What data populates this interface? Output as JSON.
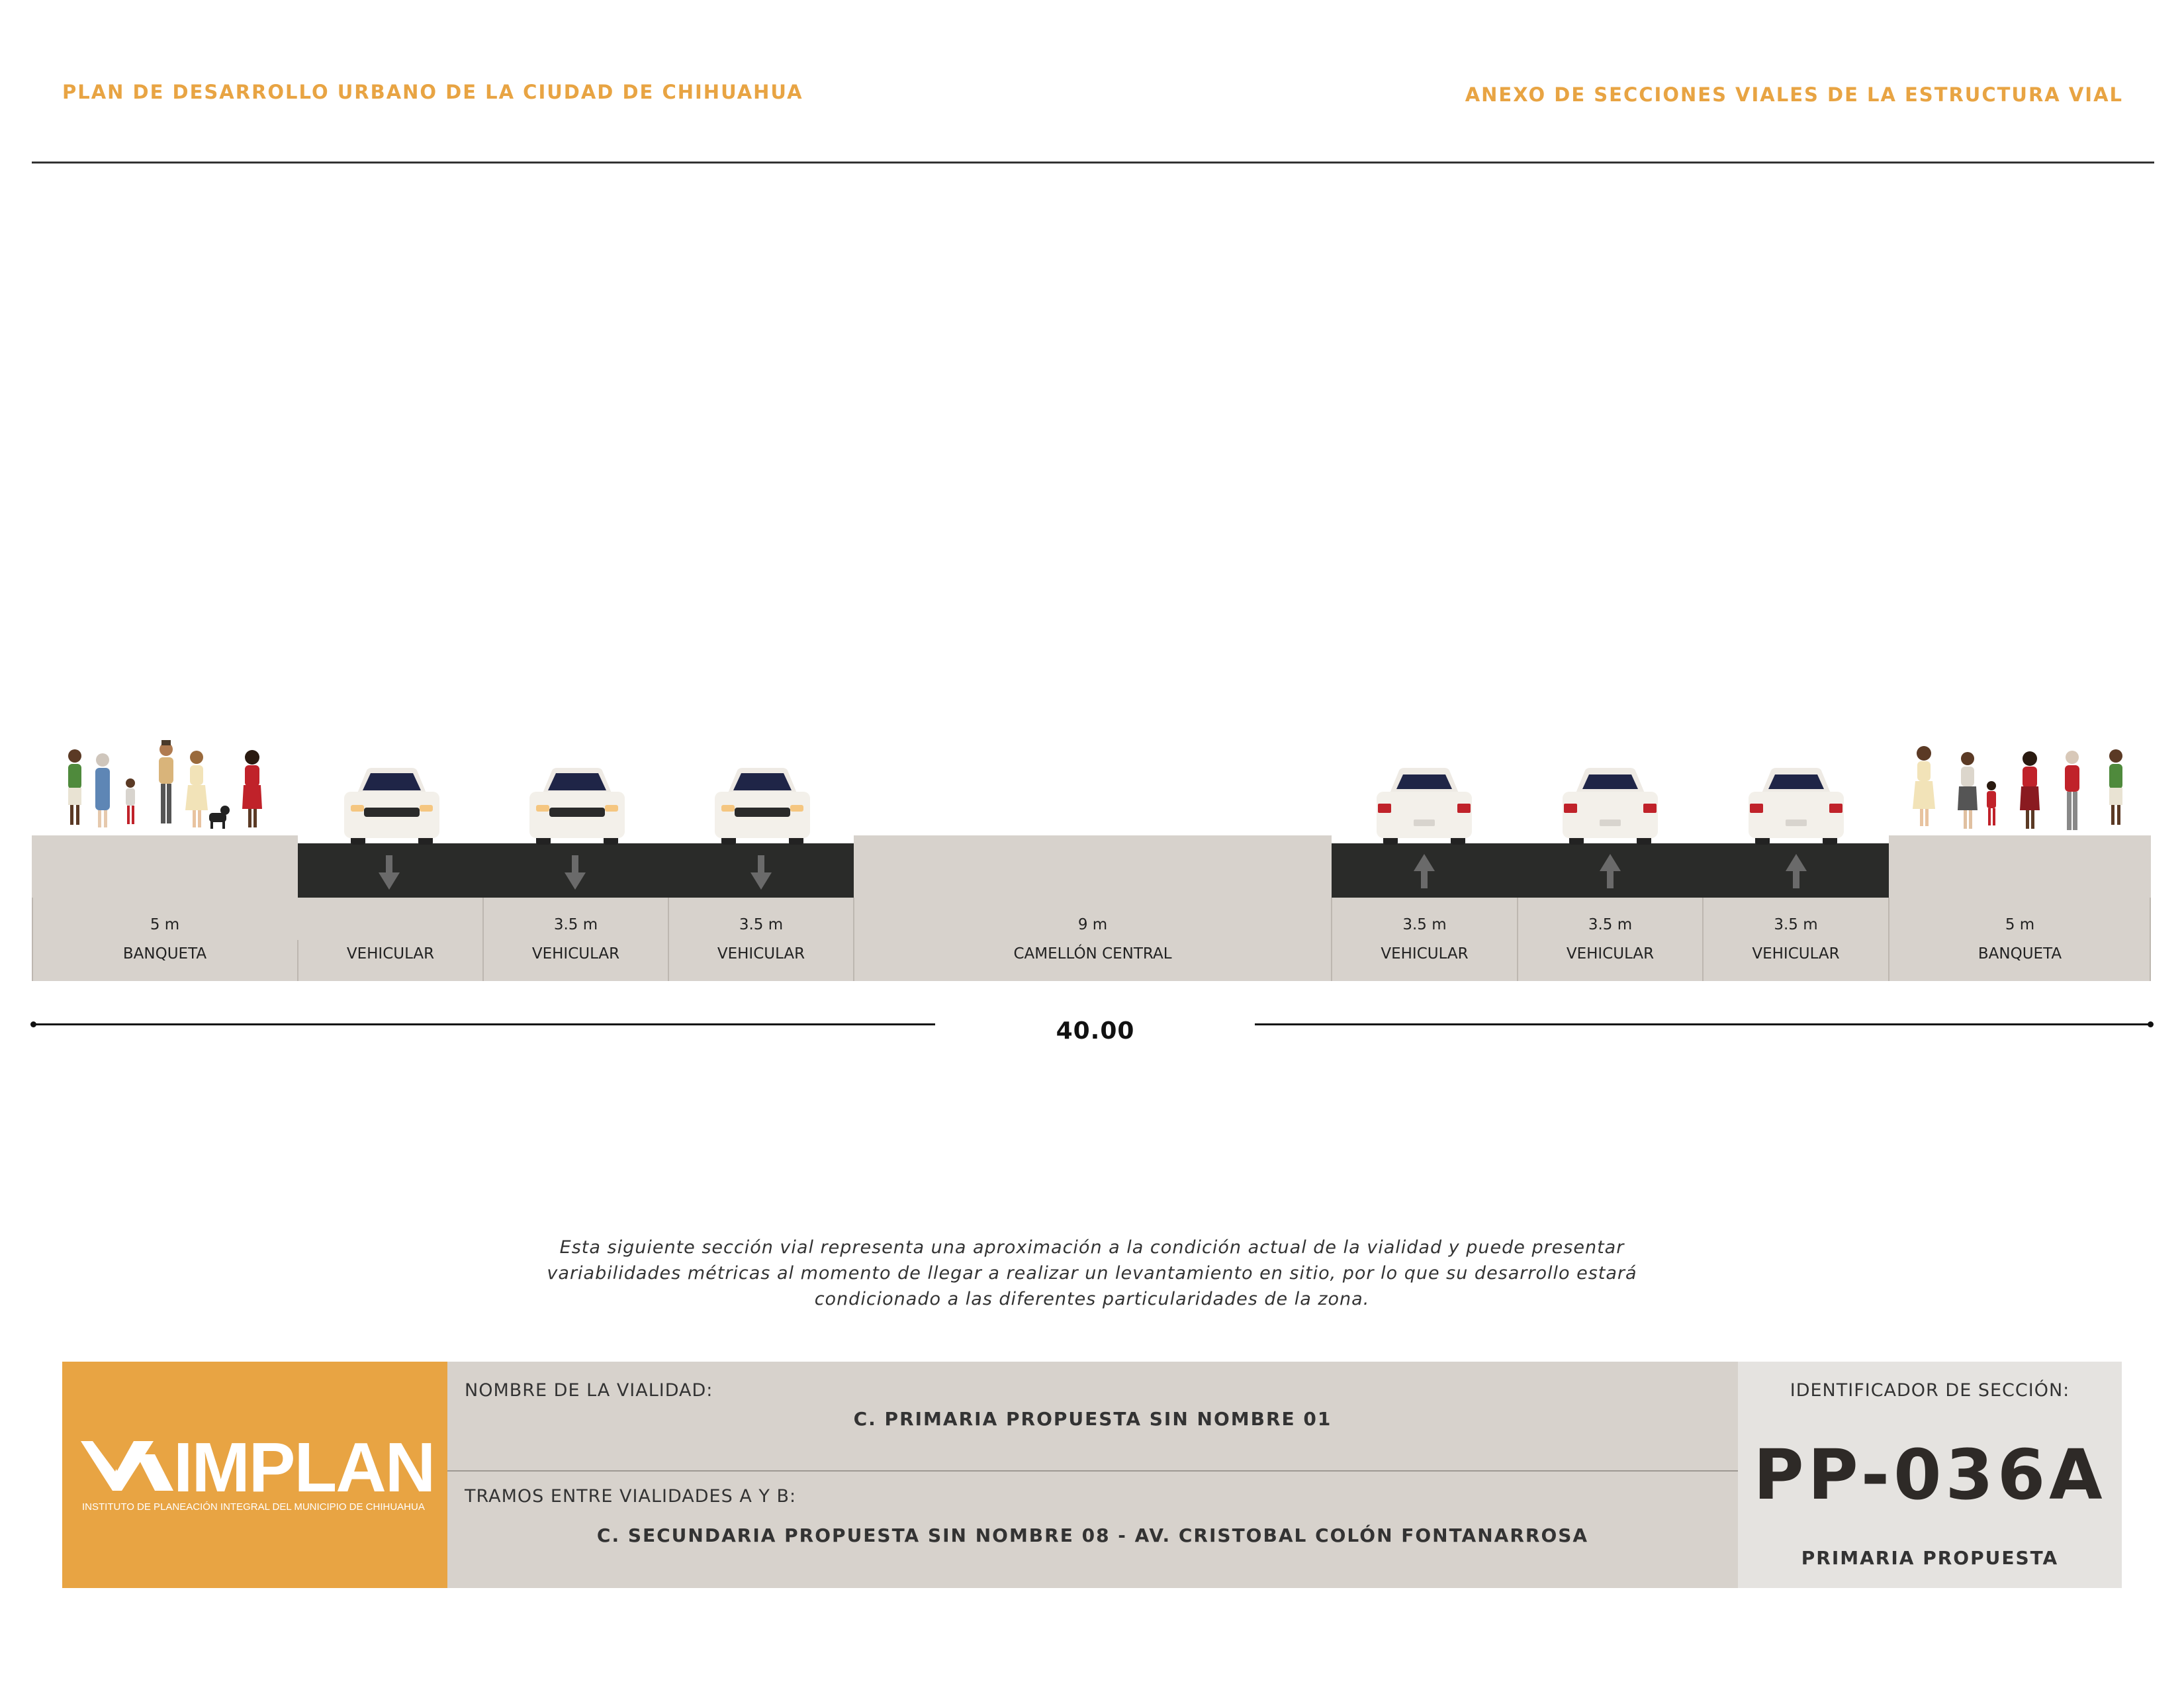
{
  "header": {
    "left_title": "PLAN DE DESARROLLO URBANO DE LA CIUDAD DE CHIHUAHUA",
    "right_title": "ANEXO DE SECCIONES VIALES DE LA ESTRUCTURA VIAL"
  },
  "section": {
    "lanes": [
      {
        "width": "5 m",
        "name": "BANQUETA"
      },
      {
        "width": "",
        "name": "VEHICULAR"
      },
      {
        "width": "3.5 m",
        "name": "VEHICULAR"
      },
      {
        "width": "3.5 m",
        "name": "VEHICULAR"
      },
      {
        "width": "9 m",
        "name": "CAMELLÓN CENTRAL"
      },
      {
        "width": "3.5 m",
        "name": "VEHICULAR"
      },
      {
        "width": "3.5 m",
        "name": "VEHICULAR"
      },
      {
        "width": "3.5 m",
        "name": "VEHICULAR"
      },
      {
        "width": "5 m",
        "name": "BANQUETA"
      }
    ],
    "total_width": "40.00"
  },
  "note": {
    "line1": "Esta siguiente sección vial representa una aproximación a la condición actual de la vialidad y puede presentar",
    "line2": "variabilidades métricas al momento de llegar a realizar un levantamiento en sitio, por lo que su desarrollo estará",
    "line3": "condicionado a las diferentes particularidades de la zona."
  },
  "footer": {
    "logo_text": "IMPLAN",
    "logo_subtitle": "INSTITUTO DE PLANEACIÓN INTEGRAL DEL MUNICIPIO DE CHIHUAHUA",
    "road_name_label": "NOMBRE DE LA VIALIDAD:",
    "road_name": "C. PRIMARIA PROPUESTA SIN NOMBRE 01",
    "segment_label": "TRAMOS ENTRE VIALIDADES A Y B:",
    "segment": "C. SECUNDARIA PROPUESTA SIN NOMBRE 08 - AV. CRISTOBAL COLÓN FONTANARROSA",
    "id_label": "IDENTIFICADOR DE SECCIÓN:",
    "section_id": "PP-036A",
    "section_type": "PRIMARIA PROPUESTA"
  },
  "colors": {
    "accent": "#e8a443",
    "asphalt": "#2a2b29",
    "ground": "#d7d2cc"
  }
}
